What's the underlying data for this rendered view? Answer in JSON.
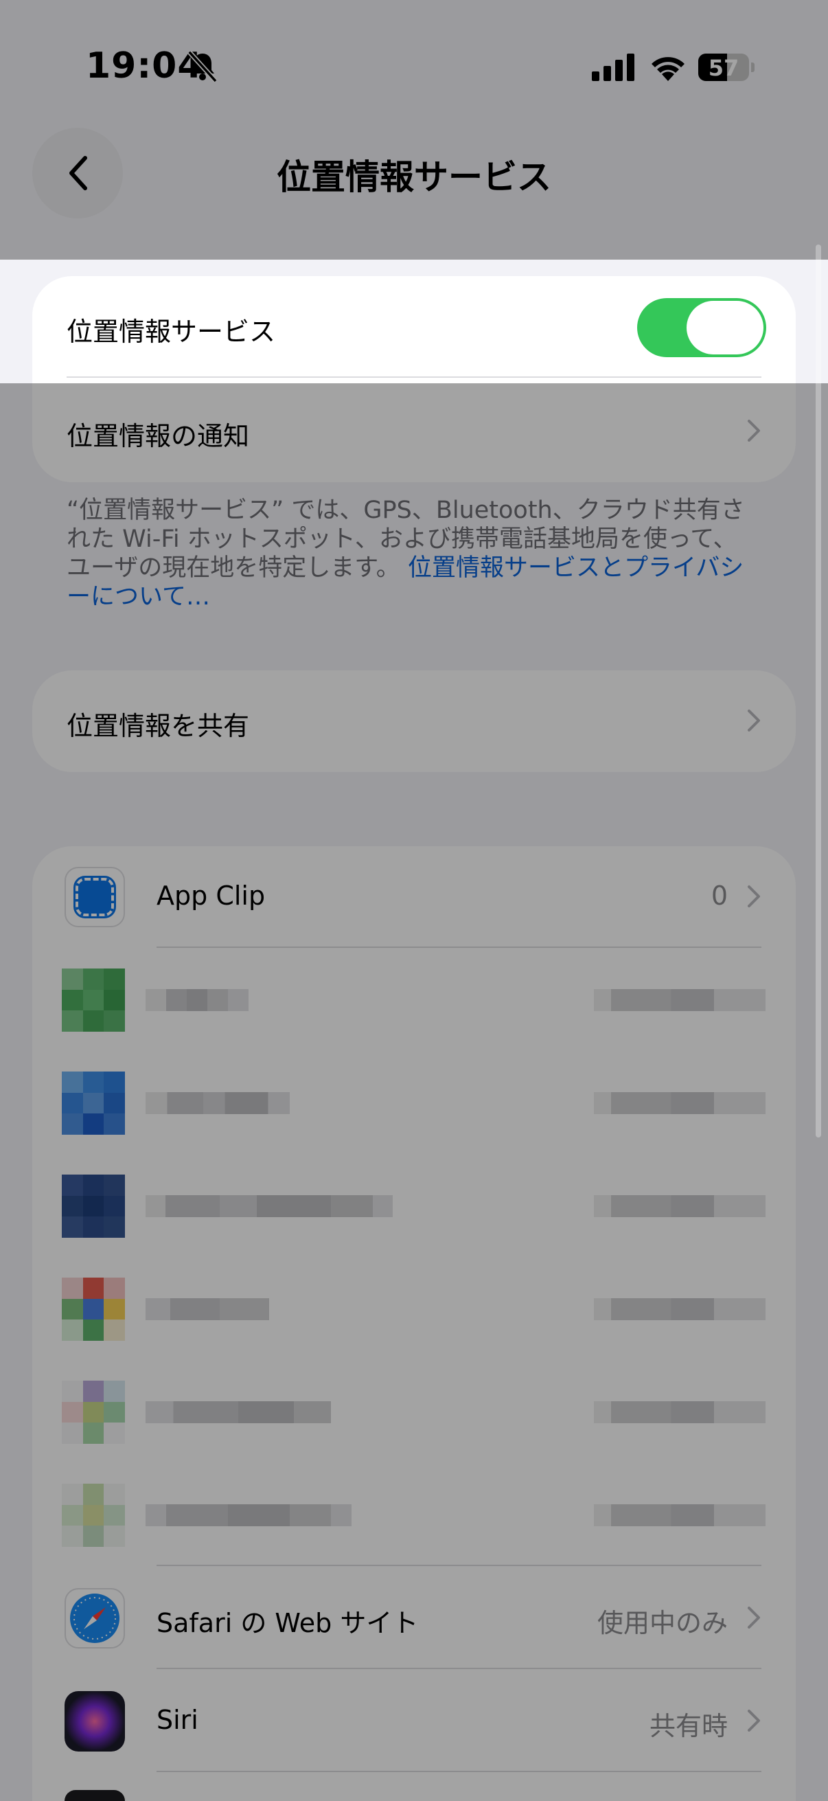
{
  "status_bar": {
    "time": "19:04",
    "battery": "57",
    "battery_level": 0.57
  },
  "nav": {
    "title": "位置情報サービス"
  },
  "location_card": {
    "toggle_label": "位置情報サービス",
    "toggle_on": true,
    "alerts_label": "位置情報の通知"
  },
  "description": {
    "text": "“位置情報サービス” では、GPS、Bluetooth、クラウド共有された Wi-Fi ホットスポット、および携帯電話基地局を使って、ユーザの現在地を特定します。",
    "link": "位置情報サービスとプライバシーについて…"
  },
  "share_card": {
    "label": "位置情報を共有"
  },
  "apps": {
    "app_clip": {
      "label": "App Clip",
      "value": "0"
    },
    "safari": {
      "label": "Safari の Web サイト",
      "value": "使用中のみ"
    },
    "siri": {
      "label": "Siri",
      "value": "共有時"
    }
  },
  "colors": {
    "accent_green": "#34c759",
    "link_blue": "#0a62d6",
    "background": "#f2f2f7"
  },
  "icons": [
    "bell-slash-icon",
    "signal-icon",
    "wifi-icon",
    "battery-icon",
    "back-chevron-icon",
    "chevron-right-icon",
    "app-clip-icon",
    "safari-icon",
    "siri-icon"
  ]
}
